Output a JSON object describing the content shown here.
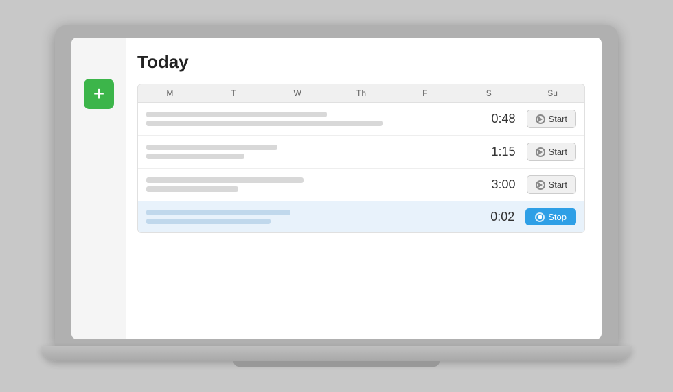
{
  "page": {
    "title": "Today"
  },
  "days": {
    "headers": [
      "M",
      "T",
      "W",
      "Th",
      "F",
      "S",
      "Su"
    ]
  },
  "entries": [
    {
      "id": 1,
      "bars": [
        {
          "width": "55%"
        },
        {
          "width": "72%"
        }
      ],
      "time": "0:48",
      "action": "Start",
      "active": false
    },
    {
      "id": 2,
      "bars": [
        {
          "width": "40%"
        },
        {
          "width": "30%"
        }
      ],
      "time": "1:15",
      "action": "Start",
      "active": false
    },
    {
      "id": 3,
      "bars": [
        {
          "width": "48%"
        },
        {
          "width": "28%"
        }
      ],
      "time": "3:00",
      "action": "Start",
      "active": false
    },
    {
      "id": 4,
      "bars": [
        {
          "width": "44%"
        },
        {
          "width": "38%"
        }
      ],
      "time": "0:02",
      "action": "Stop",
      "active": true
    }
  ],
  "buttons": {
    "add_label": "+",
    "start_label": "Start",
    "stop_label": "Stop"
  }
}
